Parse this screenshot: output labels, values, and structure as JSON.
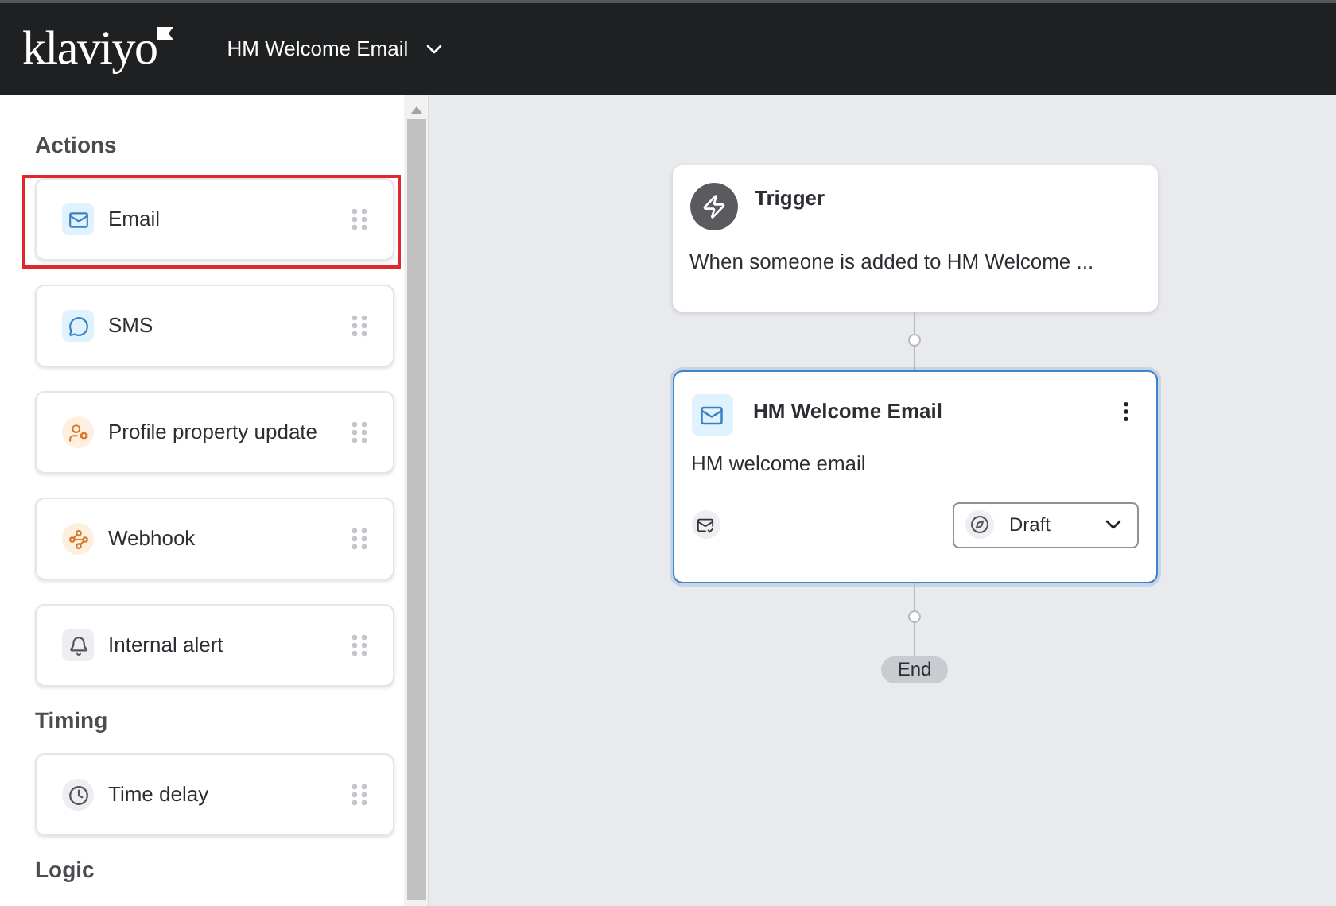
{
  "header": {
    "logo": "klaviyo",
    "flow_name": "HM Welcome Email"
  },
  "sidebar": {
    "sections": [
      {
        "title": "Actions",
        "items": [
          {
            "label": "Email",
            "kind": "email",
            "highlighted": true
          },
          {
            "label": "SMS",
            "kind": "sms",
            "highlighted": false
          },
          {
            "label": "Profile property update",
            "kind": "profile",
            "highlighted": false
          },
          {
            "label": "Webhook",
            "kind": "webhook",
            "highlighted": false
          },
          {
            "label": "Internal alert",
            "kind": "alert",
            "highlighted": false
          }
        ]
      },
      {
        "title": "Timing",
        "items": [
          {
            "label": "Time delay",
            "kind": "delay",
            "highlighted": false
          }
        ]
      },
      {
        "title": "Logic"
      }
    ]
  },
  "canvas": {
    "trigger": {
      "title": "Trigger",
      "description": "When someone is added to HM Welcome ..."
    },
    "email_node": {
      "title": "HM Welcome Email",
      "subtitle": "HM welcome email",
      "status": "Draft",
      "selected": true
    },
    "end": "End"
  }
}
